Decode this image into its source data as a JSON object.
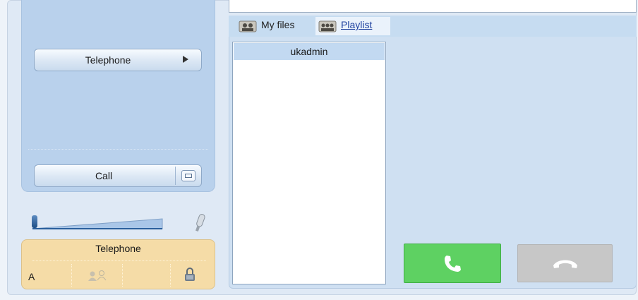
{
  "left_panel": {
    "telephone_button_label": "Telephone",
    "call_button_label": "Call"
  },
  "status_card": {
    "title": "Telephone",
    "line_letter": "A"
  },
  "tabs": [
    {
      "label": "My files",
      "icon": "user-group-icon"
    },
    {
      "label": "Playlist",
      "icon": "user-group-icon"
    }
  ],
  "user_list": {
    "items": [
      "ukadmin"
    ]
  },
  "colors": {
    "answer_green": "#5ed162",
    "hangup_gray": "#c7c7c7",
    "status_card_bg": "#f5dca7",
    "panel_blue": "#b9d1ec"
  }
}
